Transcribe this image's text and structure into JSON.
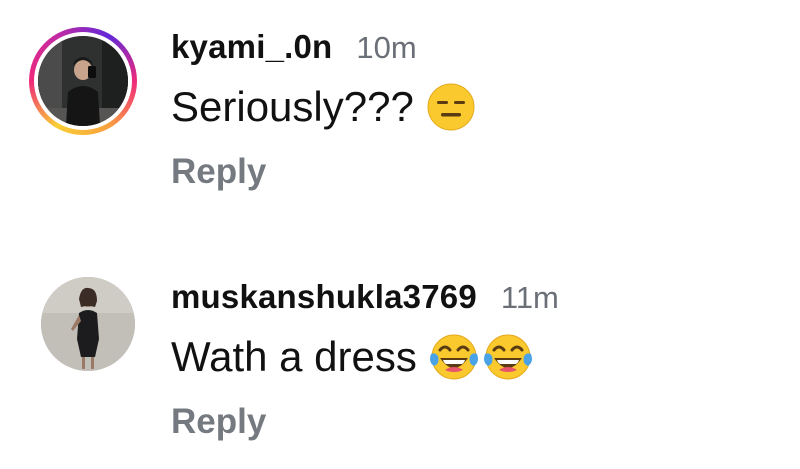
{
  "comments": [
    {
      "username": "kyami_.0n",
      "timestamp": "10m",
      "text": "Seriously???",
      "emojis": [
        "expressionless-face-icon"
      ],
      "reply_label": "Reply",
      "has_story_ring": true
    },
    {
      "username": "muskanshukla3769",
      "timestamp": "11m",
      "text": "Wath a dress",
      "emojis": [
        "tears-of-joy-face-icon",
        "tears-of-joy-face-icon"
      ],
      "reply_label": "Reply",
      "has_story_ring": false
    }
  ],
  "colors": {
    "text": "#111111",
    "muted": "#757980",
    "timestamp": "#6b6f78",
    "emoji_yellow": "#f9c92e",
    "story_ring": [
      "#f9ce34",
      "#ee2a7b",
      "#6228d7"
    ]
  }
}
